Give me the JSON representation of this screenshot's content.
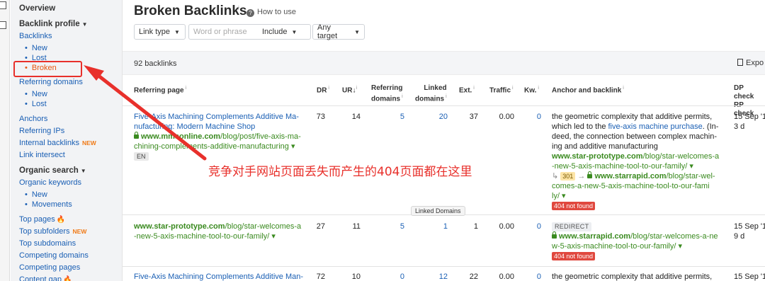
{
  "sidebar": {
    "overview": "Overview",
    "backlink_profile": "Backlink profile",
    "backlinks": "Backlinks",
    "backlinks_new": "New",
    "backlinks_lost": "Lost",
    "backlinks_broken": "Broken",
    "referring_domains": "Referring domains",
    "rd_new": "New",
    "rd_lost": "Lost",
    "anchors": "Anchors",
    "referring_ips": "Referring IPs",
    "internal_backlinks": "Internal backlinks",
    "new_tag": "NEW",
    "link_intersect": "Link intersect",
    "organic_search": "Organic search",
    "organic_keywords": "Organic keywords",
    "ok_new": "New",
    "ok_movements": "Movements",
    "top_pages": "Top pages",
    "top_subfolders": "Top subfolders",
    "top_subdomains": "Top subdomains",
    "competing_domains": "Competing domains",
    "competing_pages": "Competing pages",
    "content_gap": "Content gap"
  },
  "header": {
    "title": "Broken Backlinks",
    "info": "i",
    "how_to_use": "How to use"
  },
  "filters": {
    "link_type": "Link type",
    "word_placeholder": "Word or phrase",
    "include": "Include",
    "any_target": "Any target"
  },
  "summary": {
    "count": "92 backlinks",
    "export": "Expo"
  },
  "columns": {
    "referring_page": "Referring page",
    "dr": "DR",
    "ur": "UR",
    "referring_domains_1": "Referring",
    "referring_domains_2": "domains",
    "linked_domains_1": "Linked",
    "linked_domains_2": "domains",
    "ext": "Ext.",
    "traffic": "Traffic",
    "kw": "Kw.",
    "anchor_backlink": "Anchor and backlink",
    "dp_check": "DP check",
    "rp_check": "RP check"
  },
  "rows": [
    {
      "title_1": "Five-Axis Machining Complements Additive Ma-",
      "title_2": "nufacturing: Modern Machine Shop",
      "url_domain": "www.mmsonline.com",
      "url_path_1": "/blog/post/five-axis-ma-",
      "url_path_2": "chining-complements-additive-manufacturing",
      "lang": "EN",
      "dr": "73",
      "ur": "14",
      "ref_domains": "5",
      "linked_domains": "20",
      "ext": "37",
      "traffic": "0.00",
      "kw": "0",
      "anchor_1": "the geometric complexity that additive permits,",
      "anchor_2a": "which led to the ",
      "anchor_2b": "five-axis machine purchase",
      "anchor_2c": ". (In-",
      "anchor_3": "deed, the connection between complex machin-",
      "anchor_4": "ing and additive manufacturing",
      "bl_domain": "www.star-prototype.com",
      "bl_path_1": "/blog/star-welcomes-a",
      "bl_path_2": "-new-5-axis-machine-tool-to-our-family/",
      "redirect_code": "301",
      "redir_domain": "www.starrapid.com",
      "redir_path_1": "/blog/star-wel-",
      "redir_path_2": "comes-a-new-5-axis-machine-tool-to-our-fami",
      "redir_path_3": "ly/",
      "status": "404 not found",
      "date_1": "15 Sep '1",
      "date_2": "3 d"
    },
    {
      "url_domain": "www.star-prototype.com",
      "url_path_1": "/blog/star-welcomes-a",
      "url_path_2": "-new-5-axis-machine-tool-to-our-family/",
      "dr": "27",
      "ur": "11",
      "ref_domains": "5",
      "linked_domains": "1",
      "ext": "1",
      "traffic": "0.00",
      "kw": "0",
      "redirect_label": "REDIRECT",
      "bl_domain": "www.starrapid.com",
      "bl_path_1": "/blog/star-welcomes-a-ne",
      "bl_path_2": "w-5-axis-machine-tool-to-our-family/",
      "status": "404 not found",
      "date_1": "15 Sep '1",
      "date_2": "9 d"
    },
    {
      "title_1": "Five-Axis Machining Complements Additive Man-",
      "dr": "72",
      "ur": "10",
      "ref_domains": "0",
      "linked_domains": "12",
      "ext": "22",
      "traffic": "0.00",
      "kw": "0",
      "anchor_1": "the geometric complexity that additive permits,",
      "date_1": "15 Sep '1"
    }
  ],
  "annotation": "竞争对手网站页面丢失而产生的404页面都在这里",
  "tooltip": "Linked Domains",
  "colors": {
    "link": "#1a5fb4",
    "url_green": "#3a8a1f",
    "active_orange": "#e8550f",
    "annotation_red": "#e8302b",
    "error_red": "#e0483e"
  }
}
